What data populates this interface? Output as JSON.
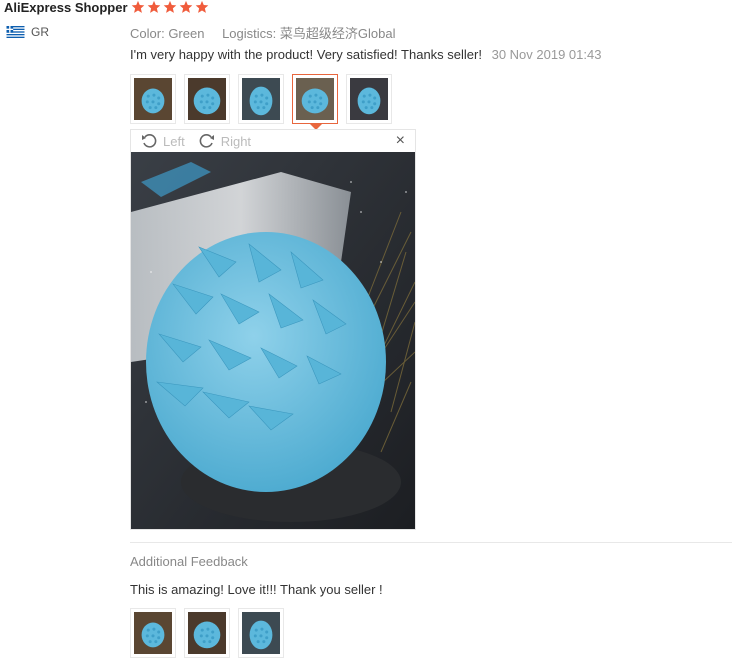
{
  "review": {
    "user_name": "AliExpress Shopper",
    "rating": 5,
    "star_color": "#f05c3c",
    "country_code": "GR",
    "color_label": "Color:",
    "color_value": "Green",
    "logistics_label": "Logistics:",
    "logistics_value": "菜鸟超级经济Global",
    "text": "I'm very happy with the product! Very satisfied! Thanks seller!",
    "date": "30 Nov 2019 01:43",
    "thumbnails": [
      {
        "icon": "brush-photo-icon"
      },
      {
        "icon": "brush-photo-icon"
      },
      {
        "icon": "brush-photo-icon"
      },
      {
        "icon": "brush-photo-icon",
        "active": true
      },
      {
        "icon": "brush-photo-icon"
      }
    ]
  },
  "viewer": {
    "rotate_left_label": "Left",
    "rotate_right_label": "Right",
    "close_glyph": "×",
    "accent_color": "#e8663d"
  },
  "additional_feedback": {
    "title": "Additional Feedback",
    "text": "This is amazing! Love it!!! Thank you seller !",
    "thumbnails": [
      {
        "icon": "brush-photo-icon"
      },
      {
        "icon": "brush-photo-icon"
      },
      {
        "icon": "brush-photo-icon"
      }
    ]
  }
}
